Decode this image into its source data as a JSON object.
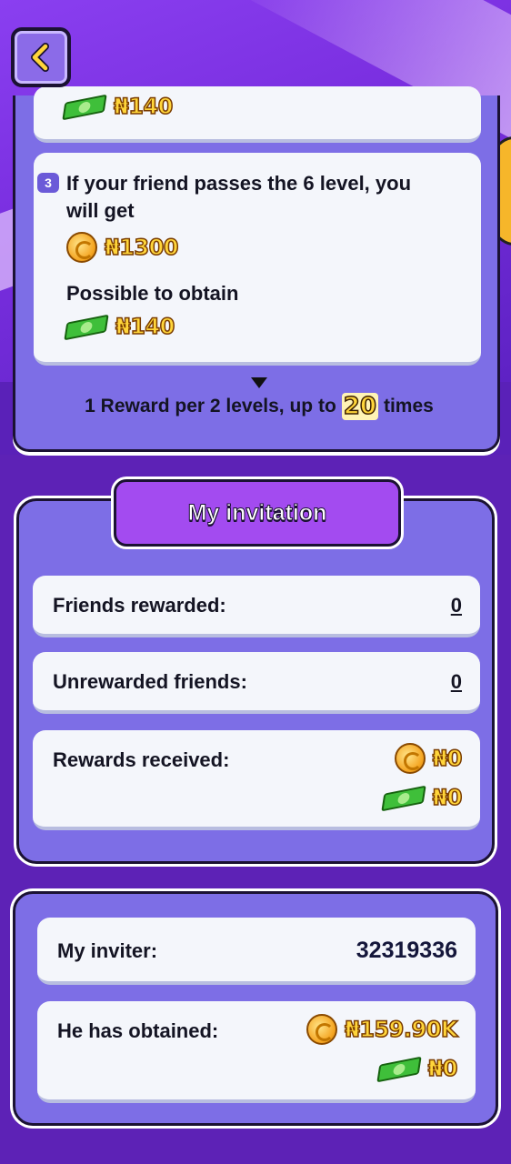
{
  "nav": {
    "back_icon": "chevron-left-icon"
  },
  "step_prev": {
    "cash_amount": "₦140"
  },
  "step3": {
    "number": "3",
    "text": "If your friend passes the 6 level, you will get",
    "coin_amount": "₦1300",
    "possible_label": "Possible to obtain",
    "cash_amount": "₦140"
  },
  "reward_note": {
    "prefix": "1 Reward per 2 levels, up to",
    "times_value": "20",
    "suffix": "times"
  },
  "my_invitation": {
    "title": "My invitation",
    "friends_rewarded_label": "Friends rewarded:",
    "friends_rewarded_value": "0",
    "unrewarded_label": "Unrewarded friends:",
    "unrewarded_value": "0",
    "rewards_received_label": "Rewards received:",
    "rewards_coin": "₦0",
    "rewards_cash": "₦0"
  },
  "inviter": {
    "label": "My inviter:",
    "value": "32319336",
    "obtained_label": "He has obtained:",
    "obtained_coin": "₦159.90K",
    "obtained_cash": "₦0"
  },
  "colors": {
    "background": "#5d22b6",
    "panel": "#7d6ee6",
    "card": "#f4f6fb",
    "amount_gold": "#ffd53a",
    "title_purple": "#a34bf0"
  }
}
